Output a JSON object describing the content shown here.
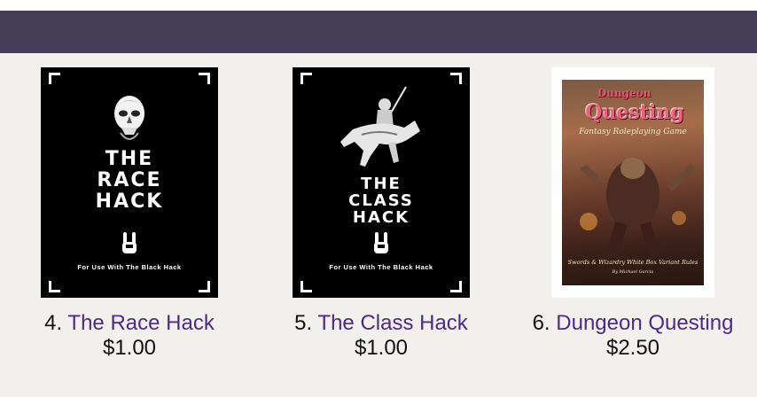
{
  "products": [
    {
      "number": "4.",
      "title": "The Race Hack",
      "price": "$1.00",
      "cover": {
        "title": "THE\nRACE\nHACK",
        "tagline": "For Use With The Black Hack",
        "art": "skull-icon"
      }
    },
    {
      "number": "5.",
      "title": "The Class Hack",
      "price": "$1.00",
      "cover": {
        "title": "THE\nCLASS\nHACK",
        "tagline": "For Use With The Black Hack",
        "art": "knight-on-horse-icon"
      }
    },
    {
      "number": "6.",
      "title": "Dungeon Questing",
      "price": "$2.50",
      "cover": {
        "logo_line1": "Dungeon",
        "logo_line2": "Questing",
        "subtitle": "Fantasy Roleplaying Game",
        "footer": "Swords & Wizardry White Box Variant Rules",
        "author": "By Michael Garcia"
      }
    }
  ],
  "colors": {
    "header_bar": "#463d59",
    "link": "#4e2a86",
    "background": "#f1f0ed"
  }
}
